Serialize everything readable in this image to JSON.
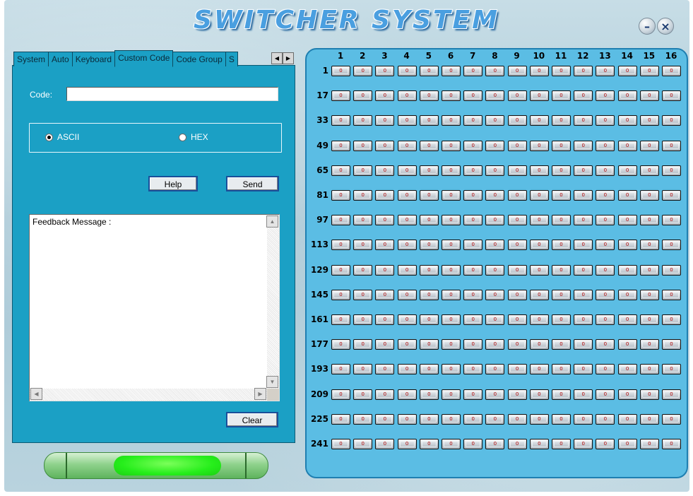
{
  "app": {
    "title": "SWITCHER SYSTEM",
    "minimize_icon": "minimize-icon",
    "close_icon": "close-icon"
  },
  "tabs": [
    {
      "label": "System",
      "active": false
    },
    {
      "label": "Auto",
      "active": false
    },
    {
      "label": "Keyboard",
      "active": false
    },
    {
      "label": "Custom Code",
      "active": true
    },
    {
      "label": "Code Group",
      "active": false
    },
    {
      "label": "S",
      "active": false
    }
  ],
  "tab_scroll": {
    "left_icon": "arrow-left-icon",
    "right_icon": "arrow-right-icon"
  },
  "custom_code": {
    "code_label": "Code:",
    "code_value": "",
    "modes": [
      {
        "label": "ASCII",
        "selected": true
      },
      {
        "label": "HEX",
        "selected": false
      }
    ],
    "help_label": "Help",
    "send_label": "Send",
    "feedback_text": "Feedback Message :",
    "clear_label": "Clear"
  },
  "progress": {
    "fill_start": 0.31,
    "fill_end": 0.79,
    "color": "#26ee1b"
  },
  "matrix": {
    "columns": [
      "1",
      "2",
      "3",
      "4",
      "5",
      "6",
      "7",
      "8",
      "9",
      "10",
      "11",
      "12",
      "13",
      "14",
      "15",
      "16"
    ],
    "rows": [
      "1",
      "17",
      "33",
      "49",
      "65",
      "81",
      "97",
      "113",
      "129",
      "145",
      "161",
      "177",
      "193",
      "209",
      "225",
      "241"
    ],
    "cell_value": "0"
  },
  "colors": {
    "panel": "#1ba0c5",
    "matrix_bg": "#5bbde4",
    "title": "#4a9fe0",
    "cell_text": "#b00000"
  }
}
